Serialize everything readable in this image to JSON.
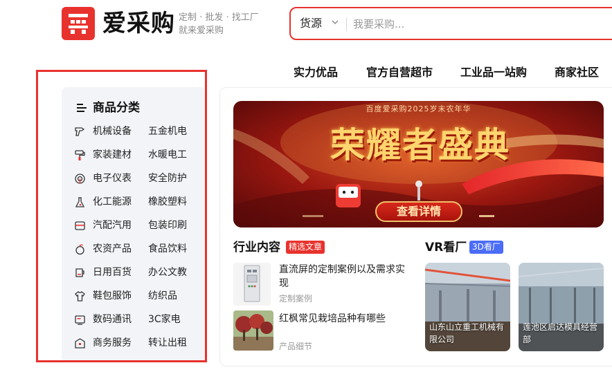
{
  "brand": {
    "logo_text": "爱采购",
    "slogan_line1": "定制 · 批发 · 找工厂",
    "slogan_line2": "就来爱采购",
    "accent": "#e8322d"
  },
  "search": {
    "category": "货源",
    "placeholder": "我要采购..."
  },
  "nav": [
    "实力优品",
    "官方自营超市",
    "工业品一站购",
    "商家社区"
  ],
  "categories": {
    "title": "商品分类",
    "rows": [
      {
        "icon": "drill-icon",
        "a": "机械设备",
        "b": "五金机电"
      },
      {
        "icon": "paint-roller-icon",
        "a": "家装建材",
        "b": "水暖电工"
      },
      {
        "icon": "signal-icon",
        "a": "电子仪表",
        "b": "安全防护"
      },
      {
        "icon": "flask-icon",
        "a": "化工能源",
        "b": "橡胶塑料"
      },
      {
        "icon": "car-box-icon",
        "a": "汽配汽用",
        "b": "包装印刷"
      },
      {
        "icon": "fruit-icon",
        "a": "农资产品",
        "b": "食品饮料"
      },
      {
        "icon": "cup-icon",
        "a": "日用百货",
        "b": "办公文教"
      },
      {
        "icon": "shirt-icon",
        "a": "鞋包服饰",
        "b": "纺织品"
      },
      {
        "icon": "monitor-icon",
        "a": "数码通讯",
        "b": "3C家电"
      },
      {
        "icon": "briefcase-icon",
        "a": "商务服务",
        "b": "转让出租"
      }
    ]
  },
  "banner": {
    "top_text": "百度爱采购2025岁末农年华",
    "title": "荣耀者盛典",
    "button": "查看详情"
  },
  "industry": {
    "title": "行业内容",
    "badge": "精选文章",
    "badge_color": "#e8322d",
    "articles": [
      {
        "title": "直流屏的定制案例以及需求实现",
        "tag": "定制案例"
      },
      {
        "title": "红枫常见栽培品种有哪些",
        "tag": "产品细节"
      }
    ]
  },
  "vr": {
    "title": "VR看厂",
    "badge": "3D看厂",
    "badge_color": "#4a6cf7",
    "factories": [
      {
        "name": "山东山立重工机械有限公司"
      },
      {
        "name": "莲池区启达模具经营部"
      }
    ]
  }
}
